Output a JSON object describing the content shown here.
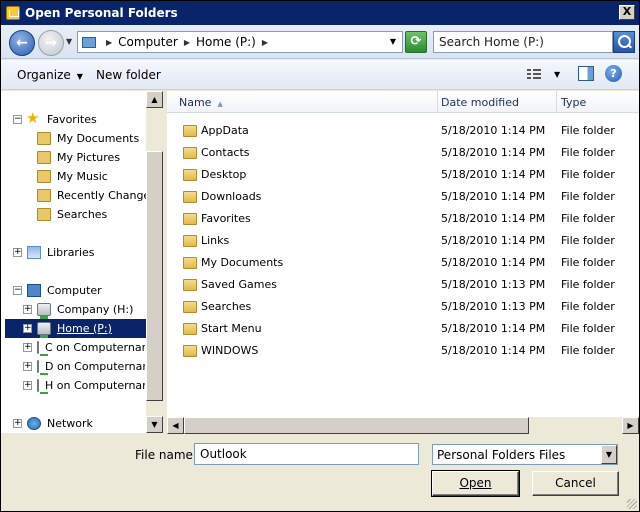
{
  "window": {
    "title": "Open Personal Folders",
    "close_label": "X"
  },
  "nav": {
    "back_glyph": "←",
    "forward_glyph": "→",
    "address_crumbs": [
      "Computer",
      "Home (P:)"
    ],
    "refresh_glyph": "⟳",
    "search_placeholder": "Search Home (P:)"
  },
  "toolbar": {
    "organize_label": "Organize",
    "new_folder_label": "New folder",
    "help_glyph": "?"
  },
  "tree": {
    "favorites": {
      "label": "Favorites",
      "items": [
        "My Documents",
        "My Pictures",
        "My Music",
        "Recently Changed",
        "Searches"
      ]
    },
    "libraries": "Libraries",
    "computer": {
      "label": "Computer",
      "drives": [
        "Company (H:)",
        "Home (P:)",
        "C on Computernam",
        "D on Computernam",
        "H on Computernam"
      ]
    },
    "network": "Network",
    "selected": "Home (P:)"
  },
  "columns": {
    "name": "Name",
    "date": "Date modified",
    "type": "Type"
  },
  "files": [
    {
      "name": "AppData",
      "date": "5/18/2010 1:14 PM",
      "type": "File folder"
    },
    {
      "name": "Contacts",
      "date": "5/18/2010 1:14 PM",
      "type": "File folder"
    },
    {
      "name": "Desktop",
      "date": "5/18/2010 1:14 PM",
      "type": "File folder"
    },
    {
      "name": "Downloads",
      "date": "5/18/2010 1:14 PM",
      "type": "File folder"
    },
    {
      "name": "Favorites",
      "date": "5/18/2010 1:14 PM",
      "type": "File folder"
    },
    {
      "name": "Links",
      "date": "5/18/2010 1:14 PM",
      "type": "File folder"
    },
    {
      "name": "My Documents",
      "date": "5/18/2010 1:14 PM",
      "type": "File folder"
    },
    {
      "name": "Saved Games",
      "date": "5/18/2010 1:13 PM",
      "type": "File folder"
    },
    {
      "name": "Searches",
      "date": "5/18/2010 1:13 PM",
      "type": "File folder"
    },
    {
      "name": "Start Menu",
      "date": "5/18/2010 1:14 PM",
      "type": "File folder"
    },
    {
      "name": "WINDOWS",
      "date": "5/18/2010 1:14 PM",
      "type": "File folder"
    }
  ],
  "bottom": {
    "file_name_label": "File name:",
    "file_name_value": "Outlook",
    "filter_value": "Personal Folders Files",
    "open_label": "Open",
    "cancel_label": "Cancel"
  },
  "colors": {
    "selection": "#0a246a",
    "title_bar": "#0a246a"
  }
}
